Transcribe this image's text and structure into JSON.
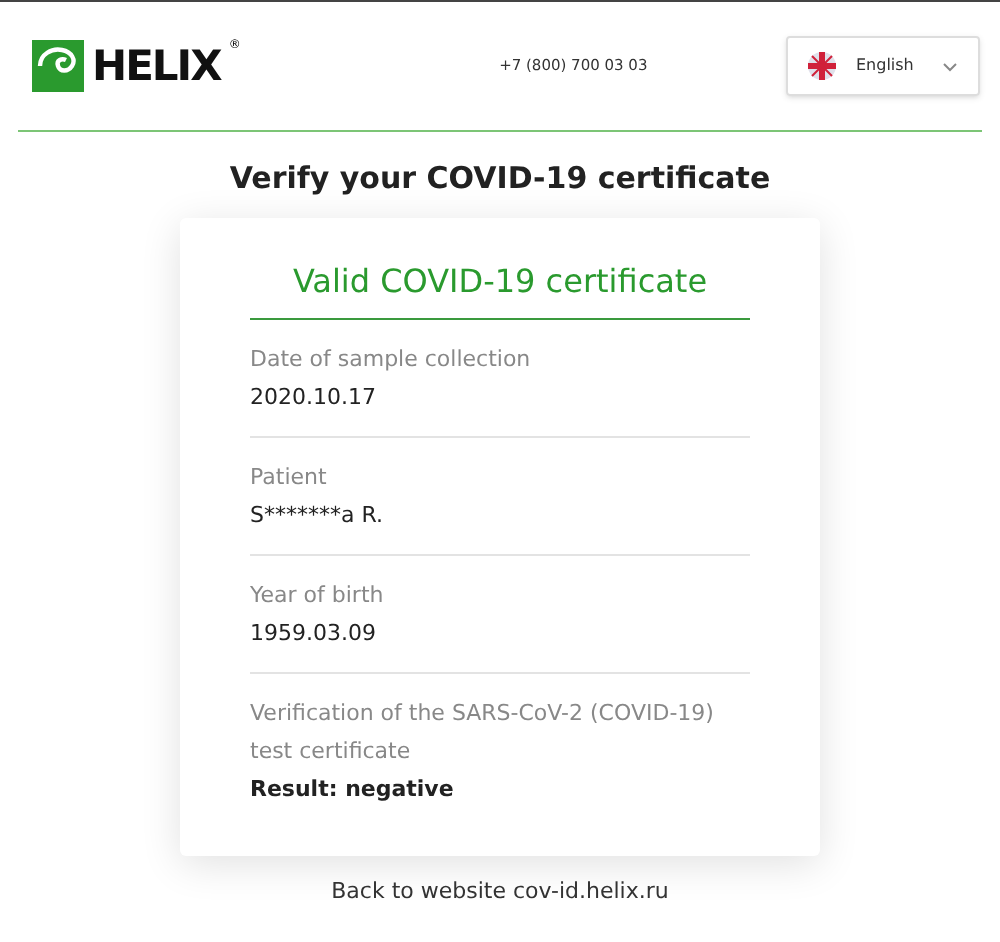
{
  "header": {
    "logo": {
      "text": "HELIX",
      "mark": "®"
    },
    "phone": "+7 (800) 700 03 03",
    "language": {
      "label": "English"
    }
  },
  "title": "Verify your COVID-19 certificate",
  "card": {
    "status": "Valid COVID-19 certificate",
    "fields": [
      {
        "label": "Date of sample collection",
        "value": "2020.10.17"
      },
      {
        "label": "Patient",
        "value": "S*******a R."
      },
      {
        "label": "Year of birth",
        "value": "1959.03.09"
      },
      {
        "label": "Verification of the SARS-CoV-2 (COVID-19) test certificate",
        "value": "Result: negative",
        "kind": "result"
      }
    ]
  },
  "footer_link": "Back to website cov-id.helix.ru"
}
